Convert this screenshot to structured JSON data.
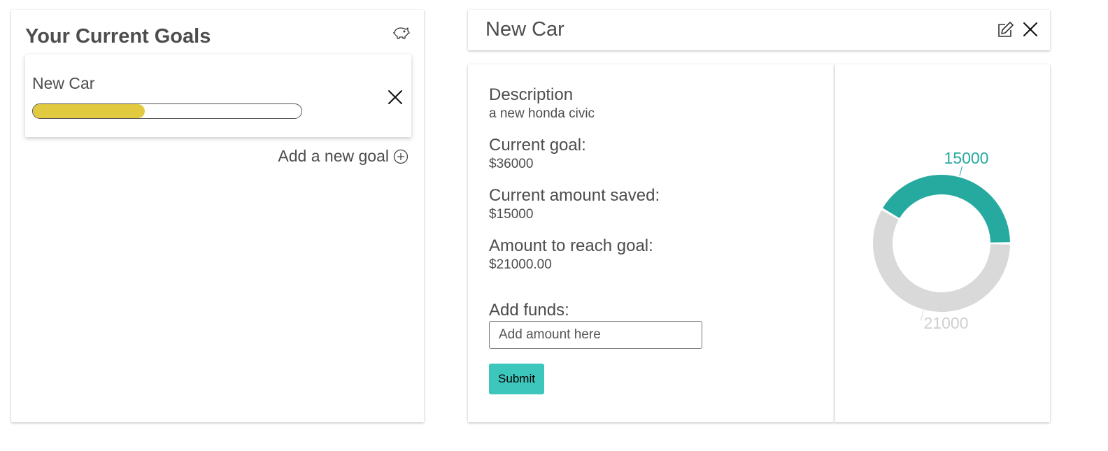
{
  "goals_panel": {
    "title": "Your Current Goals",
    "icon": "piggy-bank-icon",
    "goals": [
      {
        "name": "New Car",
        "progress": 0.4167,
        "progress_color": "#e1ca40"
      }
    ],
    "add_goal_label": "Add a new goal"
  },
  "detail": {
    "title": "New Car",
    "description_label": "Description",
    "description_value": "a new honda civic",
    "current_goal_label": "Current goal:",
    "current_goal_value": "$36000",
    "saved_label": "Current amount saved:",
    "saved_value": "$15000",
    "remaining_label": "Amount to reach goal:",
    "remaining_value": "$21000.00",
    "add_funds_label": "Add funds:",
    "add_funds_placeholder": "Add amount here",
    "submit_label": "Submit"
  },
  "colors": {
    "accent": "#3dc6bb",
    "saved": "#26aa9f",
    "remaining": "#d9d9d9"
  },
  "chart_data": {
    "type": "pie",
    "variant": "donut",
    "slices": [
      {
        "label": "21000",
        "value": 21000,
        "color": "#d9d9d9"
      },
      {
        "label": "15000",
        "value": 15000,
        "color": "#26aa9f"
      }
    ]
  }
}
